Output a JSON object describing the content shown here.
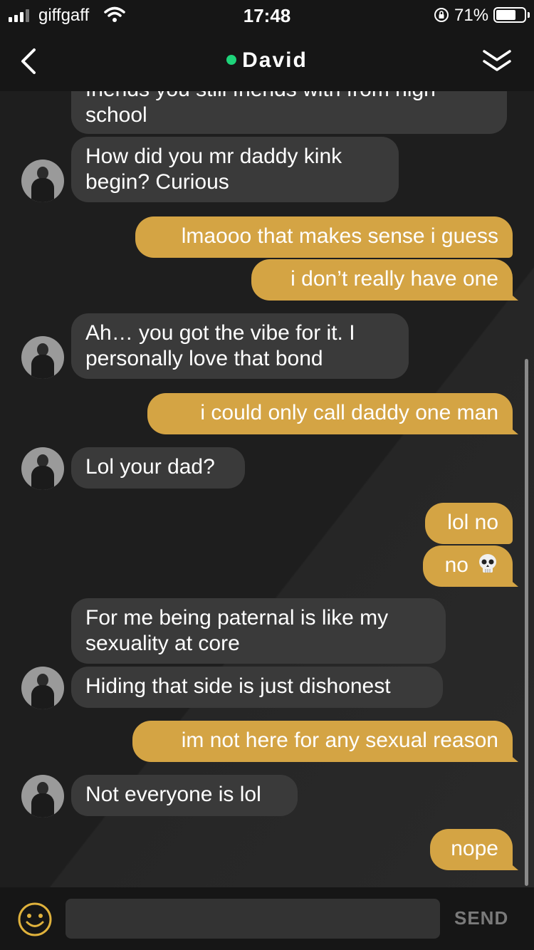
{
  "status_bar": {
    "carrier": "giffgaff",
    "time": "17:48",
    "battery": "71%",
    "battery_level": 0.71
  },
  "header": {
    "contact_name": "David",
    "online": true,
    "online_color": "#1ed37a",
    "back_icon": "chevron-left-icon",
    "collapse_icon": "double-chevron-down-icon"
  },
  "colors": {
    "background": "#1e1e1e",
    "incoming_bubble": "#3a3a3a",
    "outgoing_bubble": "#d4a444",
    "send_text": "#7a7a7a",
    "emoji_icon": "#e0b23c"
  },
  "messages": [
    {
      "dir": "in",
      "text": "friends you still friends with from high school",
      "line1": "friends you still friends with from high",
      "line2": "school"
    },
    {
      "dir": "in",
      "text": "How did you mr daddy kink begin? Curious",
      "line1": "How did you mr daddy kink",
      "line2": "begin? Curious"
    },
    {
      "dir": "out",
      "text": "lmaooo that makes sense i guess"
    },
    {
      "dir": "out",
      "text": "i don’t really have one"
    },
    {
      "dir": "in",
      "text": "Ah… you got the vibe for it. I personally love that bond",
      "line1": "Ah… you got the vibe for it. I",
      "line2": "personally love that bond"
    },
    {
      "dir": "out",
      "text": "i could only call daddy one man"
    },
    {
      "dir": "in",
      "text": "Lol your dad?"
    },
    {
      "dir": "out",
      "text": "lol no"
    },
    {
      "dir": "out",
      "text": "no",
      "emoji": "skull-icon"
    },
    {
      "dir": "in",
      "text": "For me being paternal is like my sexuality at core",
      "line1": "For me being paternal is like my",
      "line2": "sexuality at core"
    },
    {
      "dir": "in",
      "text": "Hiding that side is just dishonest"
    },
    {
      "dir": "out",
      "text": "im not here for any sexual reason"
    },
    {
      "dir": "in",
      "text": "Not everyone is lol"
    },
    {
      "dir": "out",
      "text": "nope"
    }
  ],
  "composer": {
    "emoji_icon": "smiley-icon",
    "input_value": "",
    "send_label": "SEND"
  }
}
